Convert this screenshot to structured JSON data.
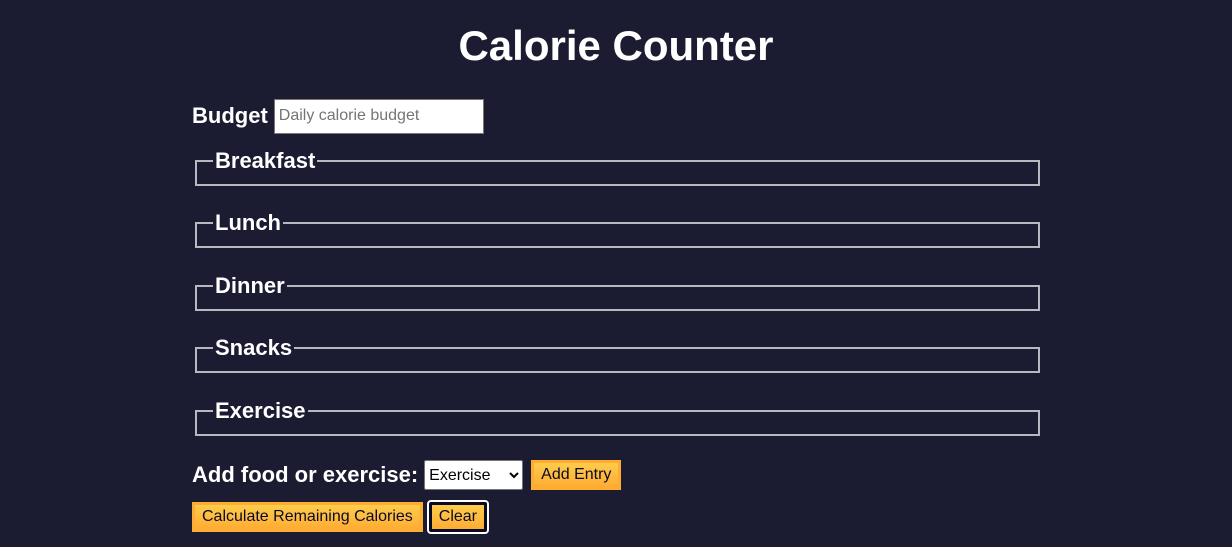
{
  "page": {
    "title": "Calorie Counter"
  },
  "budget": {
    "label": "Budget",
    "placeholder": "Daily calorie budget",
    "value": ""
  },
  "sections": [
    {
      "legend": "Breakfast"
    },
    {
      "legend": "Lunch"
    },
    {
      "legend": "Dinner"
    },
    {
      "legend": "Snacks"
    },
    {
      "legend": "Exercise"
    }
  ],
  "add_entry": {
    "label": "Add food or exercise:",
    "selected_option": "Exercise",
    "button_label": "Add Entry"
  },
  "actions": {
    "calculate_label": "Calculate Remaining Calories",
    "clear_label": "Clear"
  },
  "colors": {
    "background": "#1b1b32",
    "button": "#feac32",
    "text": "#ffffff"
  }
}
